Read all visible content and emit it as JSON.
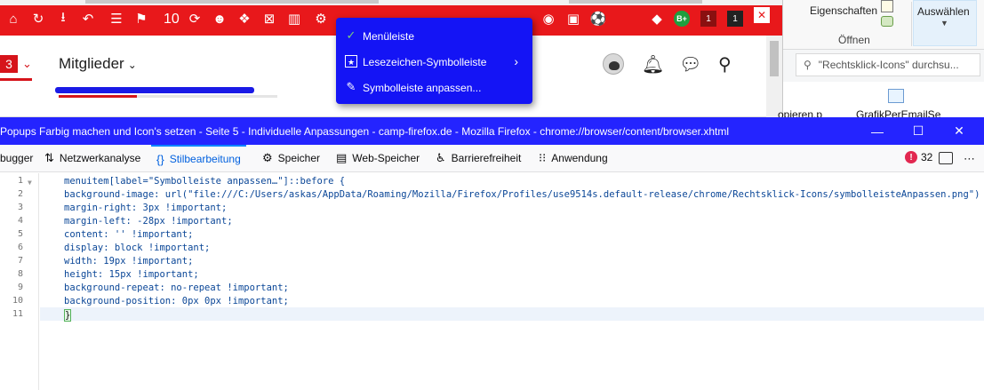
{
  "browser_toolbar": {
    "counter": "10",
    "icons": [
      "home-icon",
      "refresh-icon",
      "download-icon",
      "undo-icon",
      "counter-icon",
      "sync-icon",
      "emoji-icon",
      "puzzle-icon",
      "close-box-icon",
      "reader-icon",
      "gear-icon",
      "target-icon",
      "save-icon",
      "soccer-icon",
      "gem-icon",
      "b-plus-icon",
      "notification-icon",
      "mail-icon"
    ],
    "badges": {
      "b_plus": "B+",
      "notif1": "1",
      "notif2": "1"
    }
  },
  "context_menu": {
    "items": [
      {
        "label": "Menüleiste",
        "icon": "checkmark-icon",
        "checked": true
      },
      {
        "label": "Lesezeichen-Symbolleiste",
        "icon": "bookmarks-toolbar-icon",
        "has_submenu": true
      },
      {
        "label": "Symbolleiste anpassen...",
        "icon": "customize-icon"
      }
    ]
  },
  "webpage": {
    "notification_count": "3",
    "members_label": "Mitglieder"
  },
  "explorer": {
    "properties_label": "Eigenschaften",
    "open_label": "Öffnen",
    "select_label": "Auswählen",
    "search_placeholder": "\"Rechtsklick-Icons\" durchsu...",
    "file1_label": "opieren.p",
    "file2_label": "GrafikPerEmailSe"
  },
  "devtools": {
    "title": "Popups Farbig machen und Icon's setzen - Seite 5 - Individuelle Anpassungen - camp-firefox.de - Mozilla Firefox - chrome://browser/content/browser.xhtml",
    "tabs": [
      {
        "label": "bugger",
        "icon": ""
      },
      {
        "label": "Netzwerkanalyse",
        "icon": "network-icon"
      },
      {
        "label": "Stilbearbeitung",
        "icon": "style-editor-icon",
        "active": true
      },
      {
        "label": "Speicher",
        "icon": "memory-icon"
      },
      {
        "label": "Web-Speicher",
        "icon": "storage-icon"
      },
      {
        "label": "Barrierefreiheit",
        "icon": "accessibility-icon"
      },
      {
        "label": "Anwendung",
        "icon": "application-icon"
      }
    ],
    "error_count": "32",
    "editor": {
      "line_numbers": [
        "1",
        "2",
        "3",
        "4",
        "5",
        "6",
        "7",
        "8",
        "9",
        "10",
        "11"
      ],
      "lines": [
        "menuitem[label=\"Symbolleiste anpassen…\"]::before {",
        "background-image: url(\"file:///C:/Users/askas/AppData/Roaming/Mozilla/Firefox/Profiles/use9514s.default-release/chrome/Rechtsklick-Icons/symbolleisteAnpassen.png\") !importa",
        "margin-right: 3px !important;",
        "margin-left: -28px !important;",
        "content: '' !important;",
        "display: block !important;",
        "width: 19px !important;",
        "height: 15px !important;",
        "background-repeat: no-repeat !important;",
        "background-position: 0px 0px !important;",
        "}"
      ]
    }
  }
}
